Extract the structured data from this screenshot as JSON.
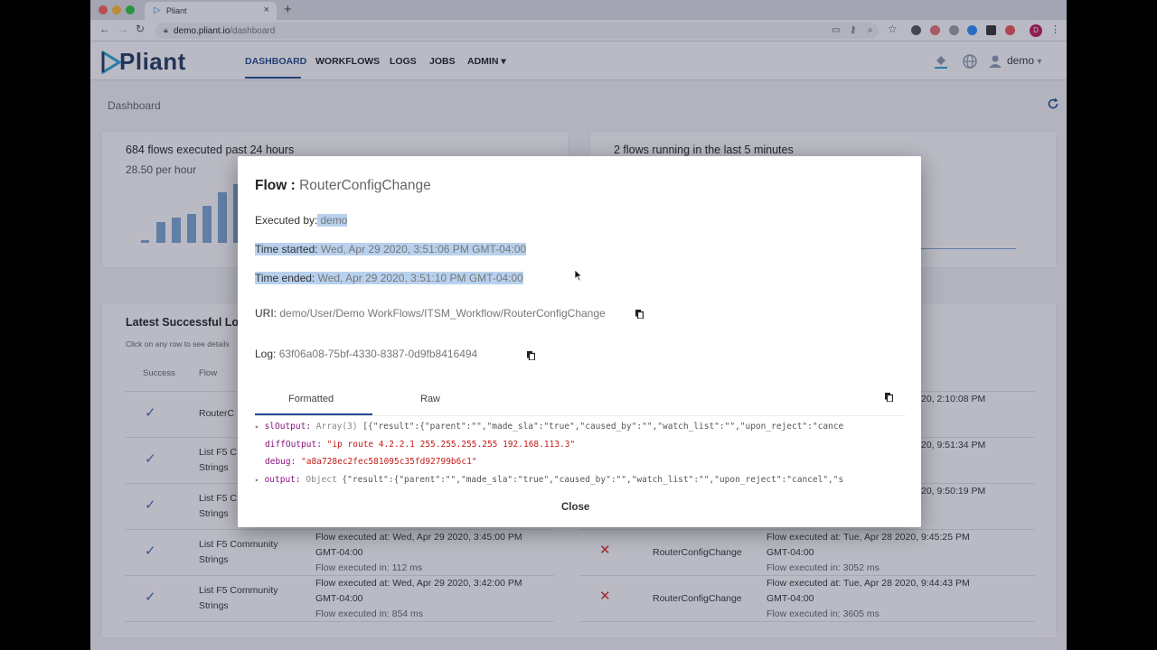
{
  "browser": {
    "tab_title": "Pliant",
    "url_host": "demo.pliant.io",
    "url_path": "/dashboard",
    "profile_initial": "D"
  },
  "app": {
    "logo_text": "Pliant",
    "nav": [
      "DASHBOARD",
      "WORKFLOWS",
      "LOGS",
      "JOBS",
      "ADMIN"
    ],
    "user": "demo"
  },
  "page": {
    "title": "Dashboard",
    "card1": {
      "title": "684 flows executed past 24 hours",
      "sub": "28.50 per hour"
    },
    "card2": {
      "title": "2 flows running in the last 5 minutes"
    },
    "table_title": "Latest Successful Lo",
    "table_hint": "Click on any row to see details",
    "headers": {
      "success": "Success",
      "flow": "Flow"
    },
    "left_rows": [
      {
        "flow": "RouterC",
        "line1": "",
        "line2": "",
        "line3": ""
      },
      {
        "flow": "List F5 C",
        "flow2": "Strings"
      },
      {
        "flow": "List F5 C",
        "flow2": "Strings"
      },
      {
        "flow": "List F5 Community",
        "flow2": "Strings",
        "line1": "Flow executed at: Wed, Apr 29 2020, 3:45:00 PM",
        "line2": "GMT-04:00",
        "line3": "Flow executed in: 112 ms"
      },
      {
        "flow": "List F5 Community",
        "flow2": "Strings",
        "line1": "Flow executed at: Wed, Apr 29 2020, 3:42:00 PM",
        "line2": "GMT-04:00",
        "line3": "Flow executed in: 854 ms"
      }
    ],
    "right_rows": [
      {
        "tail": "20, 2:10:08 PM"
      },
      {
        "tail": "20, 9:51:34 PM"
      },
      {
        "tail": "20, 9:50:19 PM"
      },
      {
        "flow": "RouterConfigChange",
        "line1": "Flow executed at: Tue, Apr 28 2020, 9:45:25 PM",
        "line2": "GMT-04:00",
        "line3": "Flow executed in: 3052 ms"
      },
      {
        "flow": "RouterConfigChange",
        "line1": "Flow executed at: Tue, Apr 28 2020, 9:44:43 PM",
        "line2": "GMT-04:00",
        "line3": "Flow executed in: 3605 ms"
      }
    ]
  },
  "chart_data": {
    "type": "bar",
    "values": [
      0.05,
      0.35,
      0.42,
      0.48,
      0.62,
      0.85,
      0.98
    ],
    "color": "#7da7d1"
  },
  "modal": {
    "title_label": "Flow :",
    "title_value": "RouterConfigChange",
    "executed_by_label": "Executed by:",
    "executed_by_value": "demo",
    "time_started_label": "Time started:",
    "time_started_value": "Wed, Apr 29 2020, 3:51:06 PM GMT-04:00",
    "time_ended_label": "Time ended:",
    "time_ended_value": "Wed, Apr 29 2020, 3:51:10 PM GMT-04:00",
    "uri_label": "URI:",
    "uri_value": "demo/User/Demo WorkFlows/ITSM_Workflow/RouterConfigChange",
    "log_label": "Log:",
    "log_value": "63f06a08-75bf-4330-8387-0d9fb8416494",
    "tabs": [
      "Formatted",
      "Raw"
    ],
    "json": {
      "k1": "slOutput:",
      "t1": "Array(3)",
      "v1": "[{\"result\":{\"parent\":\"\",\"made_sla\":\"true\",\"caused_by\":\"\",\"watch_list\":\"\",\"upon_reject\":\"cance",
      "k2": "diffOutput:",
      "v2": "\"ip route 4.2.2.1 255.255.255.255 192.168.113.3\"",
      "k3": "debug:",
      "v3": "\"a8a728ec2fec581095c35fd92799b6c1\"",
      "k4": "output:",
      "t4": "Object",
      "v4": "{\"result\":{\"parent\":\"\",\"made_sla\":\"true\",\"caused_by\":\"\",\"watch_list\":\"\",\"upon_reject\":\"cancel\",\"s"
    },
    "close_label": "Close"
  }
}
